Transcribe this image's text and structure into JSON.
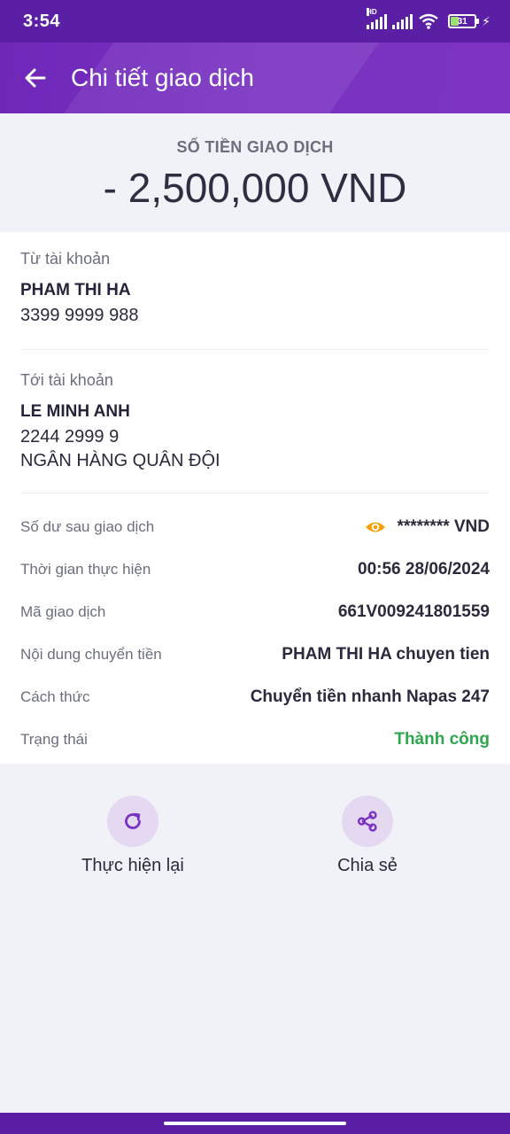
{
  "status_bar": {
    "time": "3:54",
    "battery": "31",
    "hd_label": "HD"
  },
  "header": {
    "title": "Chi tiết giao dịch"
  },
  "amount": {
    "label": "SỐ TIỀN GIAO DỊCH",
    "value": "- 2,500,000 VND"
  },
  "from_account": {
    "label": "Từ tài khoản",
    "name": "PHAM THI HA",
    "number": "3399 9999 988"
  },
  "to_account": {
    "label": "Tới tài khoản",
    "name": "LE MINH ANH",
    "number": "2244 2999 9",
    "bank": "NGÂN HÀNG QUÂN ĐỘI"
  },
  "details": {
    "balance_label": "Số dư sau giao dịch",
    "balance_value": "******** VND",
    "time_label": "Thời gian thực hiện",
    "time_value": "00:56 28/06/2024",
    "code_label": "Mã giao dịch",
    "code_value": "661V009241801559",
    "content_label": "Nội dung chuyển tiền",
    "content_value": "PHAM THI HA chuyen tien",
    "method_label": "Cách thức",
    "method_value": "Chuyển tiền nhanh Napas 247",
    "status_label": "Trạng thái",
    "status_value": "Thành công"
  },
  "actions": {
    "redo_label": "Thực hiện lại",
    "share_label": "Chia sẻ"
  },
  "icons": {
    "back": "arrow-left-icon",
    "eye": "eye-icon",
    "redo": "refresh-icon",
    "share": "share-icon"
  },
  "colors": {
    "brand": "#6e27b8",
    "status_bar": "#5b1fa6",
    "success": "#2fa64d",
    "eye": "#f5a00a",
    "action_circle": "#e4d9f1"
  }
}
